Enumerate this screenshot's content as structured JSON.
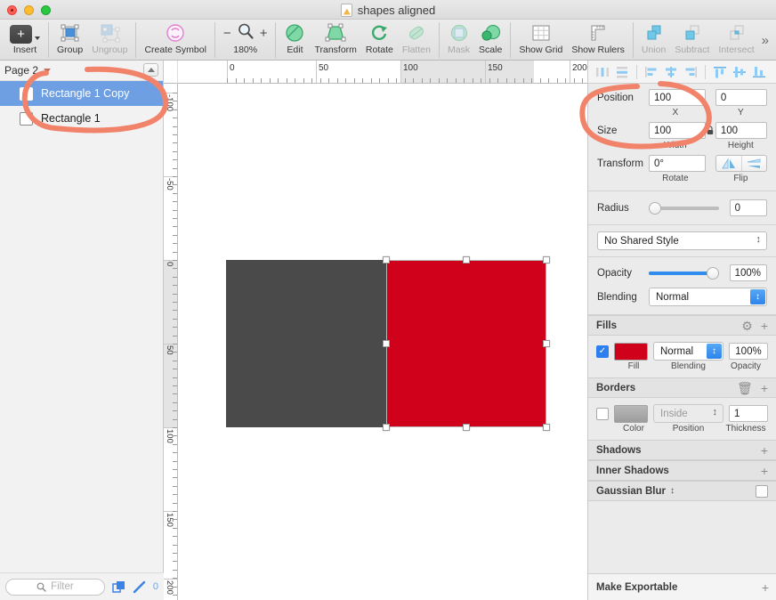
{
  "window": {
    "title": "shapes aligned",
    "doc_icon": "document-icon",
    "traffic_lights": [
      "close",
      "minimize",
      "zoom"
    ]
  },
  "toolbar": {
    "items": [
      {
        "label": "Insert",
        "icon": "plus-square-icon",
        "enabled": true
      },
      {
        "label": "Group",
        "icon": "group-icon",
        "enabled": true
      },
      {
        "label": "Ungroup",
        "icon": "ungroup-icon",
        "enabled": false
      },
      {
        "label": "Create Symbol",
        "icon": "symbol-icon",
        "enabled": true
      },
      {
        "label": "180%",
        "icon": "magnifier-icon",
        "enabled": true
      },
      {
        "label": "Edit",
        "icon": "edit-icon",
        "enabled": true
      },
      {
        "label": "Transform",
        "icon": "transform-icon",
        "enabled": true
      },
      {
        "label": "Rotate",
        "icon": "rotate-icon",
        "enabled": true
      },
      {
        "label": "Flatten",
        "icon": "flatten-icon",
        "enabled": false
      },
      {
        "label": "Mask",
        "icon": "mask-icon",
        "enabled": false
      },
      {
        "label": "Scale",
        "icon": "scale-icon",
        "enabled": true
      },
      {
        "label": "Show Grid",
        "icon": "grid-icon",
        "enabled": true
      },
      {
        "label": "Show Rulers",
        "icon": "ruler-icon",
        "enabled": true
      },
      {
        "label": "Union",
        "icon": "union-icon",
        "enabled": false
      },
      {
        "label": "Subtract",
        "icon": "subtract-icon",
        "enabled": false
      },
      {
        "label": "Intersect",
        "icon": "intersect-icon",
        "enabled": false
      }
    ],
    "zoom_minus": "−",
    "zoom_plus": "+",
    "overflow": "»"
  },
  "sidebar": {
    "page_name": "Page 2",
    "collapse_icon": "collapse-up-icon",
    "layers": [
      {
        "name": "Rectangle 1 Copy",
        "selected": true
      },
      {
        "name": "Rectangle 1",
        "selected": false
      }
    ],
    "footer": {
      "filter_placeholder": "Filter",
      "search_icon": "search-icon",
      "duplicate_icon": "duplicate-icon",
      "pencil_icon": "pencil-icon",
      "count": "0"
    }
  },
  "rulers": {
    "horizontal_ticks": [
      "0",
      "50",
      "100",
      "150",
      "200"
    ],
    "vertical_ticks": [
      "-100",
      "-50",
      "0",
      "50",
      "100",
      "150",
      "200"
    ],
    "h_highlight": [
      "100",
      "200"
    ],
    "v_highlight": [
      "0",
      "100"
    ]
  },
  "canvas": {
    "shapes": [
      {
        "name": "Rectangle 1",
        "color": "#4a4a4a",
        "selected": false
      },
      {
        "name": "Rectangle 1 Copy",
        "color": "#d0021b",
        "selected": true
      }
    ],
    "selection_handles": 8
  },
  "inspector": {
    "align_buttons": [
      "distribute-horizontal",
      "distribute-vertical",
      "align-left",
      "align-center-horizontal",
      "align-right",
      "align-top",
      "align-middle-vertical",
      "align-bottom"
    ],
    "geometry": {
      "position_label": "Position",
      "x_value": "100",
      "x_caption": "X",
      "y_value": "0",
      "y_caption": "Y",
      "size_label": "Size",
      "width_value": "100",
      "width_caption": "Width",
      "height_value": "100",
      "height_caption": "Height",
      "lock_icon": "lock-icon",
      "transform_label": "Transform",
      "rotate_value": "0°",
      "rotate_caption": "Rotate",
      "flip_caption": "Flip",
      "flip_horizontal_icon": "flip-horizontal-icon",
      "flip_vertical_icon": "flip-vertical-icon"
    },
    "radius": {
      "label": "Radius",
      "value": "0",
      "slider_pct": 0
    },
    "shared_style": {
      "value": "No Shared Style",
      "stepper_icon": "stepper-icon"
    },
    "appearance": {
      "opacity_label": "Opacity",
      "opacity_value": "100%",
      "opacity_pct": 100,
      "blending_label": "Blending",
      "blending_value": "Normal"
    },
    "fills": {
      "title": "Fills",
      "gear_icon": "gear-icon",
      "add_icon": "plus-icon",
      "enabled": true,
      "color": "#d0021b",
      "blending_value": "Normal",
      "opacity_value": "100%",
      "captions": [
        "Fill",
        "Blending",
        "Opacity"
      ]
    },
    "borders": {
      "title": "Borders",
      "trash_icon": "trash-icon",
      "add_icon": "plus-icon",
      "enabled": false,
      "color": "#9b9b9b",
      "position_value": "Inside",
      "thickness_value": "1",
      "captions": [
        "Color",
        "Position",
        "Thickness"
      ]
    },
    "shadows": {
      "title": "Shadows",
      "add_icon": "plus-icon"
    },
    "inner_shadows": {
      "title": "Inner Shadows",
      "add_icon": "plus-icon"
    },
    "gaussian_blur": {
      "title": "Gaussian Blur",
      "stepper_icon": "stepper-icon",
      "enabled": false
    },
    "make_exportable": {
      "title": "Make Exportable",
      "add_icon": "plus-icon"
    }
  },
  "annotations": {
    "color": "#f2836b",
    "shapes": [
      {
        "name": "ellipse-around-selected-layer"
      },
      {
        "name": "ellipse-around-position-size-fields"
      }
    ]
  }
}
